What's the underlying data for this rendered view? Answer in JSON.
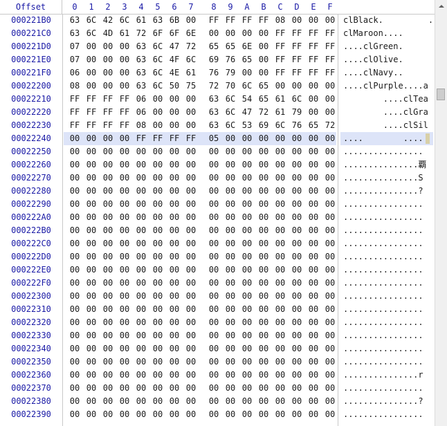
{
  "header": {
    "offset_label": "Offset",
    "columns": [
      "0",
      "1",
      "2",
      "3",
      "4",
      "5",
      "6",
      "7",
      "8",
      "9",
      "A",
      "B",
      "C",
      "D",
      "E",
      "F"
    ]
  },
  "rows": [
    {
      "offset": "000221B0",
      "bytes": [
        "63",
        "6C",
        "42",
        "6C",
        "61",
        "63",
        "6B",
        "00",
        "FF",
        "FF",
        "FF",
        "FF",
        "08",
        "00",
        "00",
        "00"
      ],
      "ascii": "clBlack.         ."
    },
    {
      "offset": "000221C0",
      "bytes": [
        "63",
        "6C",
        "4D",
        "61",
        "72",
        "6F",
        "6F",
        "6E",
        "00",
        "00",
        "00",
        "00",
        "FF",
        "FF",
        "FF",
        "FF"
      ],
      "ascii": "clMaroon...."
    },
    {
      "offset": "000221D0",
      "bytes": [
        "07",
        "00",
        "00",
        "00",
        "63",
        "6C",
        "47",
        "72",
        "65",
        "65",
        "6E",
        "00",
        "FF",
        "FF",
        "FF",
        "FF"
      ],
      "ascii": "....clGreen."
    },
    {
      "offset": "000221E0",
      "bytes": [
        "07",
        "00",
        "00",
        "00",
        "63",
        "6C",
        "4F",
        "6C",
        "69",
        "76",
        "65",
        "00",
        "FF",
        "FF",
        "FF",
        "FF"
      ],
      "ascii": "....clOlive."
    },
    {
      "offset": "000221F0",
      "bytes": [
        "06",
        "00",
        "00",
        "00",
        "63",
        "6C",
        "4E",
        "61",
        "76",
        "79",
        "00",
        "00",
        "FF",
        "FF",
        "FF",
        "FF"
      ],
      "ascii": "....clNavy.."
    },
    {
      "offset": "00022200",
      "bytes": [
        "08",
        "00",
        "00",
        "00",
        "63",
        "6C",
        "50",
        "75",
        "72",
        "70",
        "6C",
        "65",
        "00",
        "00",
        "00",
        "00"
      ],
      "ascii": "....clPurple....a"
    },
    {
      "offset": "00022210",
      "bytes": [
        "FF",
        "FF",
        "FF",
        "FF",
        "06",
        "00",
        "00",
        "00",
        "63",
        "6C",
        "54",
        "65",
        "61",
        "6C",
        "00",
        "00"
      ],
      "ascii": "        ....clTea"
    },
    {
      "offset": "00022220",
      "bytes": [
        "FF",
        "FF",
        "FF",
        "FF",
        "06",
        "00",
        "00",
        "00",
        "63",
        "6C",
        "47",
        "72",
        "61",
        "79",
        "00",
        "00"
      ],
      "ascii": "        ....clGra"
    },
    {
      "offset": "00022230",
      "bytes": [
        "FF",
        "FF",
        "FF",
        "FF",
        "08",
        "00",
        "00",
        "00",
        "63",
        "6C",
        "53",
        "69",
        "6C",
        "76",
        "65",
        "72"
      ],
      "ascii": "        ....clSil"
    },
    {
      "offset": "00022240",
      "bytes": [
        "00",
        "00",
        "00",
        "00",
        "FF",
        "FF",
        "FF",
        "FF",
        "05",
        "00",
        "00",
        "00",
        "00",
        "00",
        "00",
        "00"
      ],
      "ascii": "....        ...."
    },
    {
      "offset": "00022250",
      "bytes": [
        "00",
        "00",
        "00",
        "00",
        "00",
        "00",
        "00",
        "00",
        "00",
        "00",
        "00",
        "00",
        "00",
        "00",
        "00",
        "00"
      ],
      "ascii": "................"
    },
    {
      "offset": "00022260",
      "bytes": [
        "00",
        "00",
        "00",
        "00",
        "00",
        "00",
        "00",
        "00",
        "00",
        "00",
        "00",
        "00",
        "00",
        "00",
        "00",
        "00"
      ],
      "ascii": "...............覇"
    },
    {
      "offset": "00022270",
      "bytes": [
        "00",
        "00",
        "00",
        "00",
        "00",
        "00",
        "00",
        "00",
        "00",
        "00",
        "00",
        "00",
        "00",
        "00",
        "00",
        "00"
      ],
      "ascii": "...............S"
    },
    {
      "offset": "00022280",
      "bytes": [
        "00",
        "00",
        "00",
        "00",
        "00",
        "00",
        "00",
        "00",
        "00",
        "00",
        "00",
        "00",
        "00",
        "00",
        "00",
        "00"
      ],
      "ascii": "...............?"
    },
    {
      "offset": "00022290",
      "bytes": [
        "00",
        "00",
        "00",
        "00",
        "00",
        "00",
        "00",
        "00",
        "00",
        "00",
        "00",
        "00",
        "00",
        "00",
        "00",
        "00"
      ],
      "ascii": "................"
    },
    {
      "offset": "000222A0",
      "bytes": [
        "00",
        "00",
        "00",
        "00",
        "00",
        "00",
        "00",
        "00",
        "00",
        "00",
        "00",
        "00",
        "00",
        "00",
        "00",
        "00"
      ],
      "ascii": "................"
    },
    {
      "offset": "000222B0",
      "bytes": [
        "00",
        "00",
        "00",
        "00",
        "00",
        "00",
        "00",
        "00",
        "00",
        "00",
        "00",
        "00",
        "00",
        "00",
        "00",
        "00"
      ],
      "ascii": "................"
    },
    {
      "offset": "000222C0",
      "bytes": [
        "00",
        "00",
        "00",
        "00",
        "00",
        "00",
        "00",
        "00",
        "00",
        "00",
        "00",
        "00",
        "00",
        "00",
        "00",
        "00"
      ],
      "ascii": "................"
    },
    {
      "offset": "000222D0",
      "bytes": [
        "00",
        "00",
        "00",
        "00",
        "00",
        "00",
        "00",
        "00",
        "00",
        "00",
        "00",
        "00",
        "00",
        "00",
        "00",
        "00"
      ],
      "ascii": "................"
    },
    {
      "offset": "000222E0",
      "bytes": [
        "00",
        "00",
        "00",
        "00",
        "00",
        "00",
        "00",
        "00",
        "00",
        "00",
        "00",
        "00",
        "00",
        "00",
        "00",
        "00"
      ],
      "ascii": "................"
    },
    {
      "offset": "000222F0",
      "bytes": [
        "00",
        "00",
        "00",
        "00",
        "00",
        "00",
        "00",
        "00",
        "00",
        "00",
        "00",
        "00",
        "00",
        "00",
        "00",
        "00"
      ],
      "ascii": "................"
    },
    {
      "offset": "00022300",
      "bytes": [
        "00",
        "00",
        "00",
        "00",
        "00",
        "00",
        "00",
        "00",
        "00",
        "00",
        "00",
        "00",
        "00",
        "00",
        "00",
        "00"
      ],
      "ascii": "................"
    },
    {
      "offset": "00022310",
      "bytes": [
        "00",
        "00",
        "00",
        "00",
        "00",
        "00",
        "00",
        "00",
        "00",
        "00",
        "00",
        "00",
        "00",
        "00",
        "00",
        "00"
      ],
      "ascii": "................"
    },
    {
      "offset": "00022320",
      "bytes": [
        "00",
        "00",
        "00",
        "00",
        "00",
        "00",
        "00",
        "00",
        "00",
        "00",
        "00",
        "00",
        "00",
        "00",
        "00",
        "00"
      ],
      "ascii": "................"
    },
    {
      "offset": "00022330",
      "bytes": [
        "00",
        "00",
        "00",
        "00",
        "00",
        "00",
        "00",
        "00",
        "00",
        "00",
        "00",
        "00",
        "00",
        "00",
        "00",
        "00"
      ],
      "ascii": "................"
    },
    {
      "offset": "00022340",
      "bytes": [
        "00",
        "00",
        "00",
        "00",
        "00",
        "00",
        "00",
        "00",
        "00",
        "00",
        "00",
        "00",
        "00",
        "00",
        "00",
        "00"
      ],
      "ascii": "................"
    },
    {
      "offset": "00022350",
      "bytes": [
        "00",
        "00",
        "00",
        "00",
        "00",
        "00",
        "00",
        "00",
        "00",
        "00",
        "00",
        "00",
        "00",
        "00",
        "00",
        "00"
      ],
      "ascii": "................"
    },
    {
      "offset": "00022360",
      "bytes": [
        "00",
        "00",
        "00",
        "00",
        "00",
        "00",
        "00",
        "00",
        "00",
        "00",
        "00",
        "00",
        "00",
        "00",
        "00",
        "00"
      ],
      "ascii": "...............r"
    },
    {
      "offset": "00022370",
      "bytes": [
        "00",
        "00",
        "00",
        "00",
        "00",
        "00",
        "00",
        "00",
        "00",
        "00",
        "00",
        "00",
        "00",
        "00",
        "00",
        "00"
      ],
      "ascii": "................"
    },
    {
      "offset": "00022380",
      "bytes": [
        "00",
        "00",
        "00",
        "00",
        "00",
        "00",
        "00",
        "00",
        "00",
        "00",
        "00",
        "00",
        "00",
        "00",
        "00",
        "00"
      ],
      "ascii": "...............?"
    },
    {
      "offset": "00022390",
      "bytes": [
        "00",
        "00",
        "00",
        "00",
        "00",
        "00",
        "00",
        "00",
        "00",
        "00",
        "00",
        "00",
        "00",
        "00",
        "00",
        "00"
      ],
      "ascii": "................"
    }
  ],
  "selection": {
    "row_offset": "00022240"
  },
  "colors": {
    "offset_text": "#1a1aa6",
    "highlight": "#dde4f8",
    "divider": "#c8c8c8"
  },
  "icons": {
    "scroll_up": "arrow-up-icon"
  }
}
